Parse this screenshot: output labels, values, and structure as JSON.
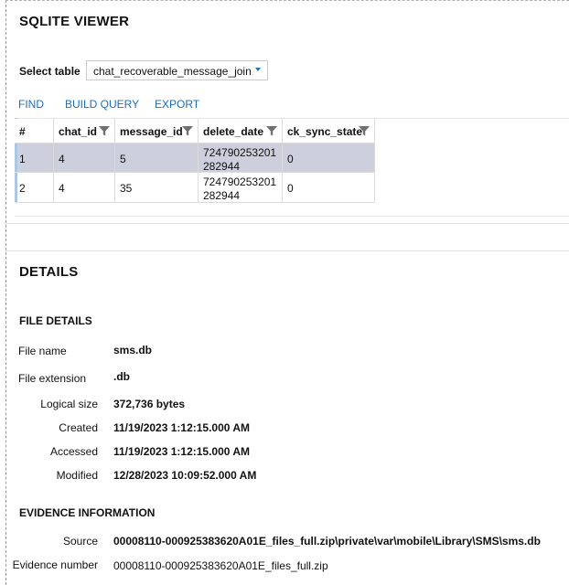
{
  "viewer": {
    "title": "SQLITE VIEWER",
    "select_label": "Select table",
    "selected_table": "chat_recoverable_message_join",
    "toolbar": {
      "find": "FIND",
      "build_query": "BUILD QUERY",
      "export": "EXPORT"
    },
    "columns": [
      "#",
      "chat_id",
      "message_id",
      "delete_date",
      "ck_sync_state"
    ],
    "rows": [
      {
        "num": "1",
        "chat_id": "4",
        "message_id": "5",
        "delete_date_1": "724790253201",
        "delete_date_2": "282944",
        "ck_sync_state": "0"
      },
      {
        "num": "2",
        "chat_id": "4",
        "message_id": "35",
        "delete_date_1": "724790253201",
        "delete_date_2": "282944",
        "ck_sync_state": "0"
      }
    ],
    "icons": {
      "filter": "filter-icon",
      "dropdown": "chevron-down-icon"
    },
    "colors": {
      "accent": "#1a6fbf",
      "selected_row": "#cdd0dc"
    }
  },
  "details": {
    "title": "DETAILS",
    "file_details_title": "FILE DETAILS",
    "file_name_label": "File name",
    "file_name": "sms.db",
    "file_extension_label": "File extension",
    "file_extension": ".db",
    "logical_size_label": "Logical size",
    "logical_size": "372,736 bytes",
    "created_label": "Created",
    "created": "11/19/2023 1:12:15.000 AM",
    "accessed_label": "Accessed",
    "accessed": "11/19/2023 1:12:15.000 AM",
    "modified_label": "Modified",
    "modified": "12/28/2023 10:09:52.000 AM",
    "evidence_title": "EVIDENCE INFORMATION",
    "source_label": "Source",
    "source": "00008110-000925383620A01E_files_full.zip\\private\\var\\mobile\\Library\\SMS\\sms.db",
    "evidence_number_label": "Evidence number",
    "evidence_number": "00008110-000925383620A01E_files_full.zip"
  }
}
